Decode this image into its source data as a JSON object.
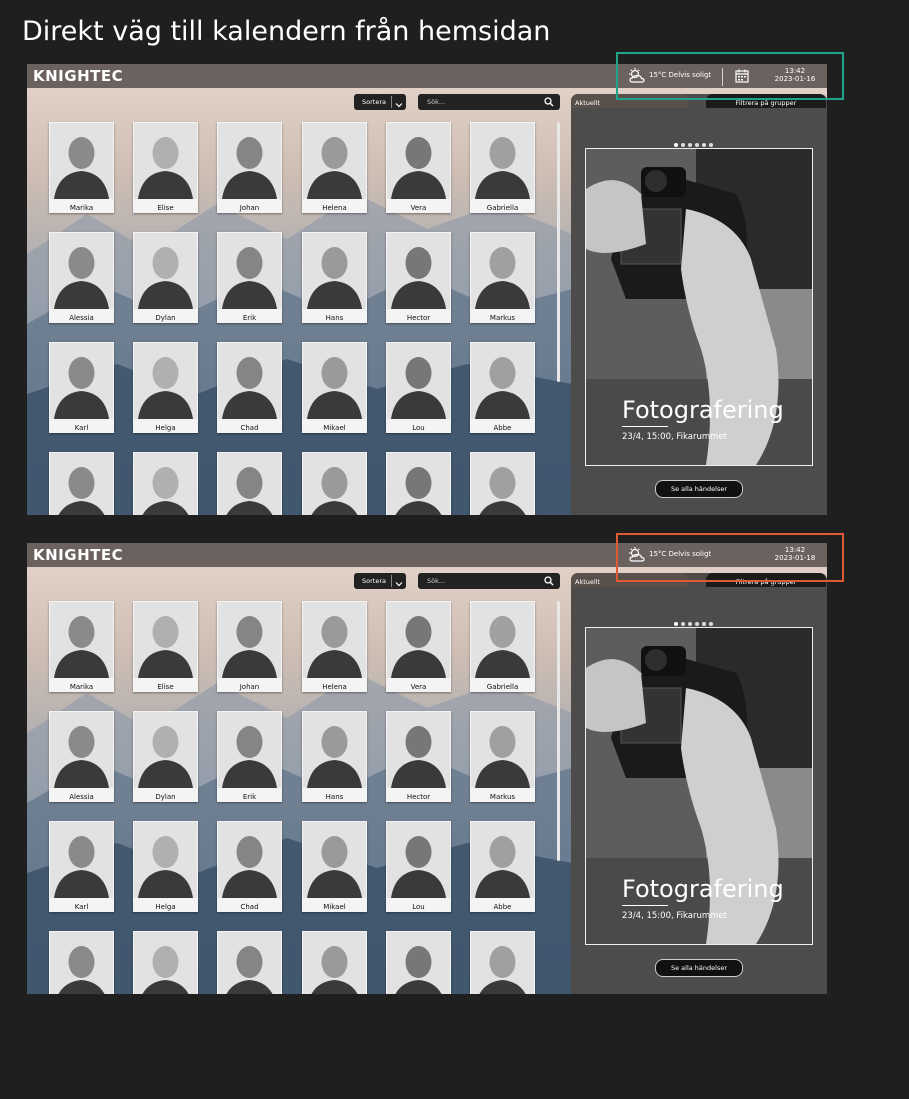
{
  "page": {
    "title": "Direkt väg till kalendern från hemsidan"
  },
  "app": {
    "logo": "KNIGHTEC"
  },
  "weather": {
    "text": "15°C Delvis soligt",
    "icon": "partly-sunny-icon"
  },
  "time": {
    "clock": "13:42",
    "date1": "2023-01-16",
    "date2": "2023-01-18"
  },
  "controls": {
    "sort_label": "Sortera",
    "search_placeholder": "Sök..."
  },
  "tabs": {
    "current": "Aktuellt",
    "filter": "Filtrera på grupper"
  },
  "carousel": {
    "dots": 6,
    "active": 1
  },
  "event": {
    "title": "Fotografering",
    "meta": "23/4, 15:00, Fikarummet"
  },
  "actions": {
    "all_events": "Se alla händelser"
  },
  "people": [
    "Marika",
    "Elise",
    "Johan",
    "Helena",
    "Vera",
    "Gabriella",
    "Alessia",
    "Dylan",
    "Erik",
    "Hans",
    "Hector",
    "Markus",
    "Karl",
    "Helga",
    "Chad",
    "Mikael",
    "Lou",
    "Abbe",
    "",
    "",
    "",
    "",
    "",
    ""
  ],
  "colors": {
    "highlight_top": "#1fa38a",
    "highlight_bottom": "#e05a33",
    "topbar": "#6b625f",
    "panel": "#4e4b4b"
  }
}
